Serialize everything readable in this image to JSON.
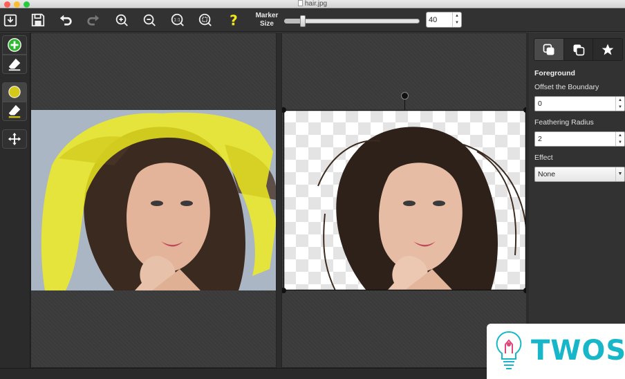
{
  "window": {
    "title": "hair.jpg"
  },
  "toolbar": {
    "buttons": [
      "import-icon",
      "save-icon",
      "undo-icon",
      "redo-icon",
      "zoom-in-icon",
      "zoom-out-icon",
      "actual-size-icon",
      "fit-view-icon",
      "help-icon"
    ],
    "help_glyph": "?",
    "marker_size_label_1": "Marker",
    "marker_size_label_2": "Size",
    "marker_size_value": "40",
    "marker_size_fraction": 0.12
  },
  "left_tools": [
    "add-foreground-marker-icon",
    "foreground-eraser-icon",
    "background-marker-icon",
    "background-eraser-icon",
    "move-icon"
  ],
  "colors": {
    "foreground_marker": "#2eb82e",
    "background_marker": "#d4c91a",
    "highlight_yellow": "#f2ee1e",
    "help_yellow": "#f2e61c",
    "brand": "#17b7c9"
  },
  "right_panel": {
    "tabs": [
      "foreground-tab-icon",
      "background-tab-icon",
      "favorites-tab-icon"
    ],
    "section_title": "Foreground",
    "offset_label": "Offset the Boundary",
    "offset_value": "0",
    "feather_label": "Feathering Radius",
    "feather_value": "2",
    "effect_label": "Effect",
    "effect_value": "None"
  },
  "watermark": {
    "text": "TWOS"
  }
}
